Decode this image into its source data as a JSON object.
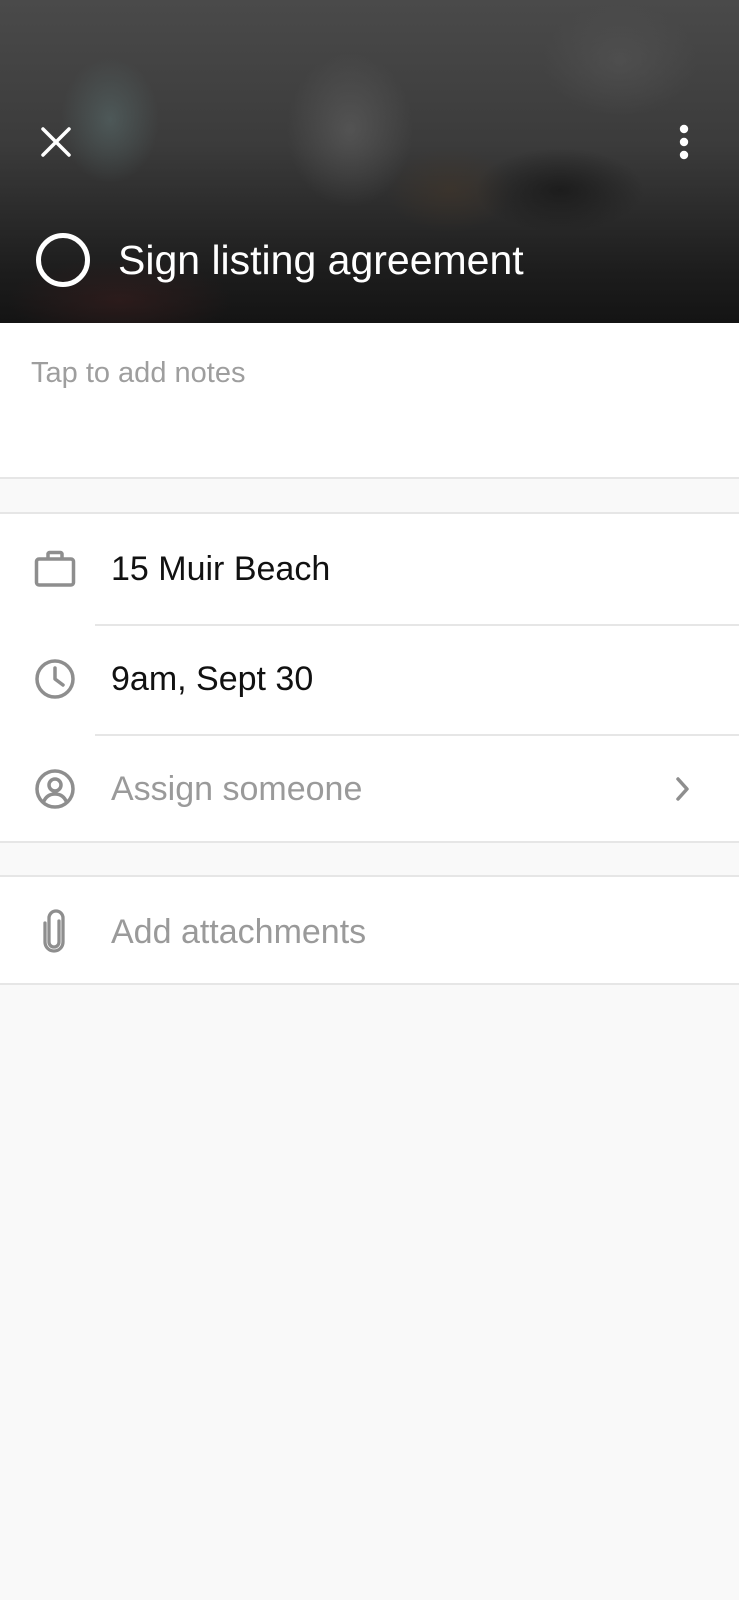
{
  "header": {
    "close_icon": "close-icon",
    "more_icon": "more-vertical-icon",
    "task_title": "Sign listing agreement",
    "toggle_icon": "circle-outline-icon"
  },
  "notes": {
    "placeholder": "Tap to add notes"
  },
  "details": {
    "property": {
      "icon": "briefcase-icon",
      "value": "15 Muir Beach"
    },
    "due": {
      "icon": "clock-icon",
      "value": "9am, Sept 30"
    },
    "assignee": {
      "icon": "user-circle-icon",
      "placeholder": "Assign someone",
      "chevron_icon": "chevron-right-icon"
    }
  },
  "attachments": {
    "icon": "paperclip-icon",
    "placeholder": "Add attachments"
  },
  "colors": {
    "icon_gray": "#8e8e8e",
    "muted_text": "#9a9a9a",
    "divider": "#e6e6e6",
    "background": "#f9f9f9"
  }
}
